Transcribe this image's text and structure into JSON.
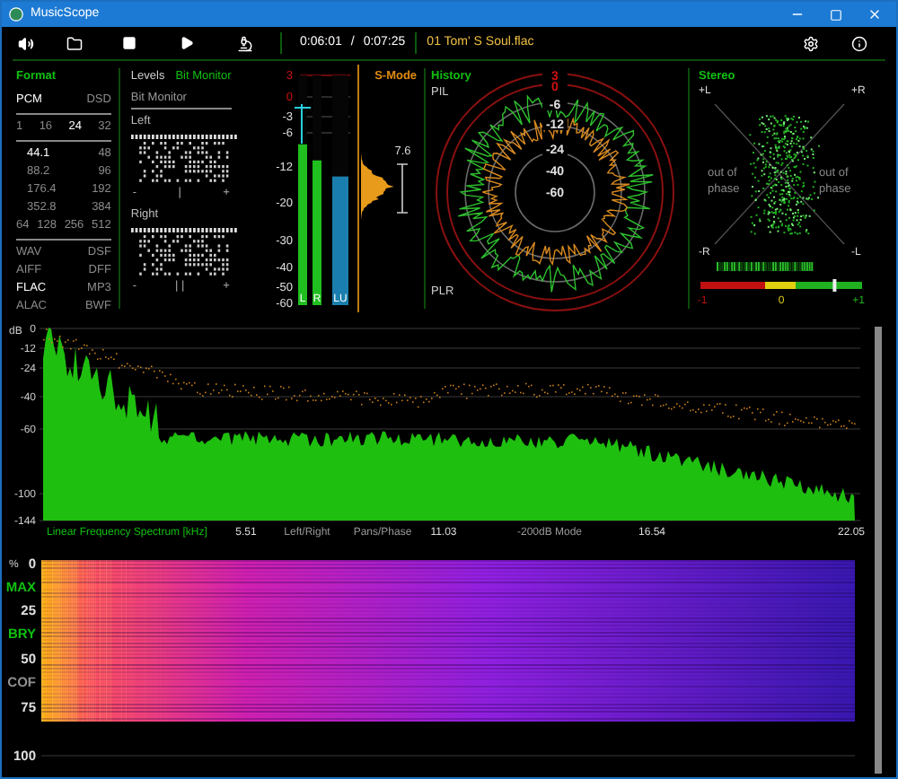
{
  "window": {
    "title": "MusicScope"
  },
  "toolbar": {
    "elapsed": "0:06:01",
    "separator": "/",
    "total": "0:07:25",
    "track": "01 Tom' S Soul.flac"
  },
  "format": {
    "title": "Format",
    "groups": [
      [
        [
          {
            "label": "PCM",
            "active": true
          },
          {
            "label": "DSD",
            "active": false
          }
        ]
      ],
      [
        [
          {
            "label": "1",
            "active": false
          },
          {
            "label": "16",
            "active": false
          },
          {
            "label": "24",
            "active": true
          },
          {
            "label": "32",
            "active": false
          }
        ]
      ],
      [
        [
          {
            "label": "44.1",
            "active": true
          },
          {
            "label": "48",
            "active": false
          }
        ],
        [
          {
            "label": "88.2",
            "active": false
          },
          {
            "label": "96",
            "active": false
          }
        ],
        [
          {
            "label": "176.4",
            "active": false
          },
          {
            "label": "192",
            "active": false
          }
        ],
        [
          {
            "label": "352.8",
            "active": false
          },
          {
            "label": "384",
            "active": false
          }
        ],
        [
          {
            "label": "64",
            "active": false
          },
          {
            "label": "128",
            "active": false
          },
          {
            "label": "256",
            "active": false
          },
          {
            "label": "512",
            "active": false
          }
        ]
      ],
      [
        [
          {
            "label": "WAV",
            "active": false
          },
          {
            "label": "DSF",
            "active": false
          }
        ],
        [
          {
            "label": "AIFF",
            "active": false
          },
          {
            "label": "DFF",
            "active": false
          }
        ],
        [
          {
            "label": "FLAC",
            "active": true
          },
          {
            "label": "MP3",
            "active": false
          }
        ],
        [
          {
            "label": "ALAC",
            "active": false
          },
          {
            "label": "BWF",
            "active": false
          }
        ]
      ]
    ]
  },
  "levels": {
    "tabs": [
      {
        "label": "Levels",
        "selected": false
      },
      {
        "label": "Bit Monitor",
        "selected": true
      }
    ],
    "subtitle": "Bit Monitor",
    "channels": [
      {
        "name": "Left",
        "minus": "-",
        "marker": "|",
        "plus": "+"
      },
      {
        "name": "Right",
        "minus": "-",
        "marker": "| |",
        "plus": "+"
      }
    ]
  },
  "meter": {
    "scale": [
      {
        "label": "3",
        "color": "#d01010"
      },
      {
        "label": "0",
        "color": "#d01010"
      },
      {
        "label": "-3",
        "color": "#e0e0e0"
      },
      {
        "label": "-6",
        "color": "#e0e0e0"
      },
      {
        "label": "-12",
        "color": "#e0e0e0"
      },
      {
        "label": "-20",
        "color": "#e0e0e0"
      },
      {
        "label": "-30",
        "color": "#e0e0e0"
      },
      {
        "label": "-40",
        "color": "#e0e0e0"
      },
      {
        "label": "-50",
        "color": "#e0e0e0"
      },
      {
        "label": "-60",
        "color": "#e0e0e0"
      }
    ],
    "bars": [
      {
        "label": "L",
        "level": 0.7,
        "color": "#1fbf1f"
      },
      {
        "label": "R",
        "level": 0.63,
        "color": "#1fbf1f"
      },
      {
        "label": "LU",
        "level": 0.56,
        "color": "#1a7fae"
      }
    ]
  },
  "s_mode": {
    "title": "S-Mode",
    "reading": "7.6"
  },
  "history": {
    "title": "History",
    "top_label": "PIL",
    "bottom_label": "PLR",
    "rings": [
      {
        "label": "3",
        "color": "#d01010"
      },
      {
        "label": "0",
        "color": "#d01010"
      },
      {
        "label": "-6",
        "color": "#e0e0e0"
      },
      {
        "label": "-12",
        "color": "#e0e0e0"
      },
      {
        "label": "-24",
        "color": "#e0e0e0"
      },
      {
        "label": "-40",
        "color": "#e0e0e0"
      },
      {
        "label": "-60",
        "color": "#e0e0e0"
      }
    ]
  },
  "stereo": {
    "title": "Stereo",
    "corners": [
      "+L",
      "+R",
      "-R",
      "-L"
    ],
    "phase_labels": [
      "out of phase",
      "out of phase"
    ],
    "correlation": {
      "level": 0.83,
      "ticks": [
        "-1",
        "0",
        "+1"
      ]
    }
  },
  "spectrum": {
    "unit": "dB",
    "yticks": [
      "0",
      "-12",
      "-24",
      "-40",
      "-60",
      "-100",
      "-144"
    ],
    "title": "Linear Frequency Spectrum [kHz]",
    "xticks": [
      "5.51",
      "11.03",
      "16.54",
      "22.05"
    ],
    "modes": [
      "Left/Right",
      "Pans/Phase",
      "-200dB Mode"
    ]
  },
  "spectrogram": {
    "unit": "%",
    "scale": [
      {
        "label": "0",
        "color": "#e0e0e0"
      },
      {
        "label": "MAX",
        "color": "#10c010"
      },
      {
        "label": "25",
        "color": "#e0e0e0"
      },
      {
        "label": "BRY",
        "color": "#10c010"
      },
      {
        "label": "50",
        "color": "#e0e0e0"
      },
      {
        "label": "COF",
        "color": "#909090"
      },
      {
        "label": "75",
        "color": "#e0e0e0"
      },
      {
        "label": "100",
        "color": "#e0e0e0"
      }
    ]
  }
}
